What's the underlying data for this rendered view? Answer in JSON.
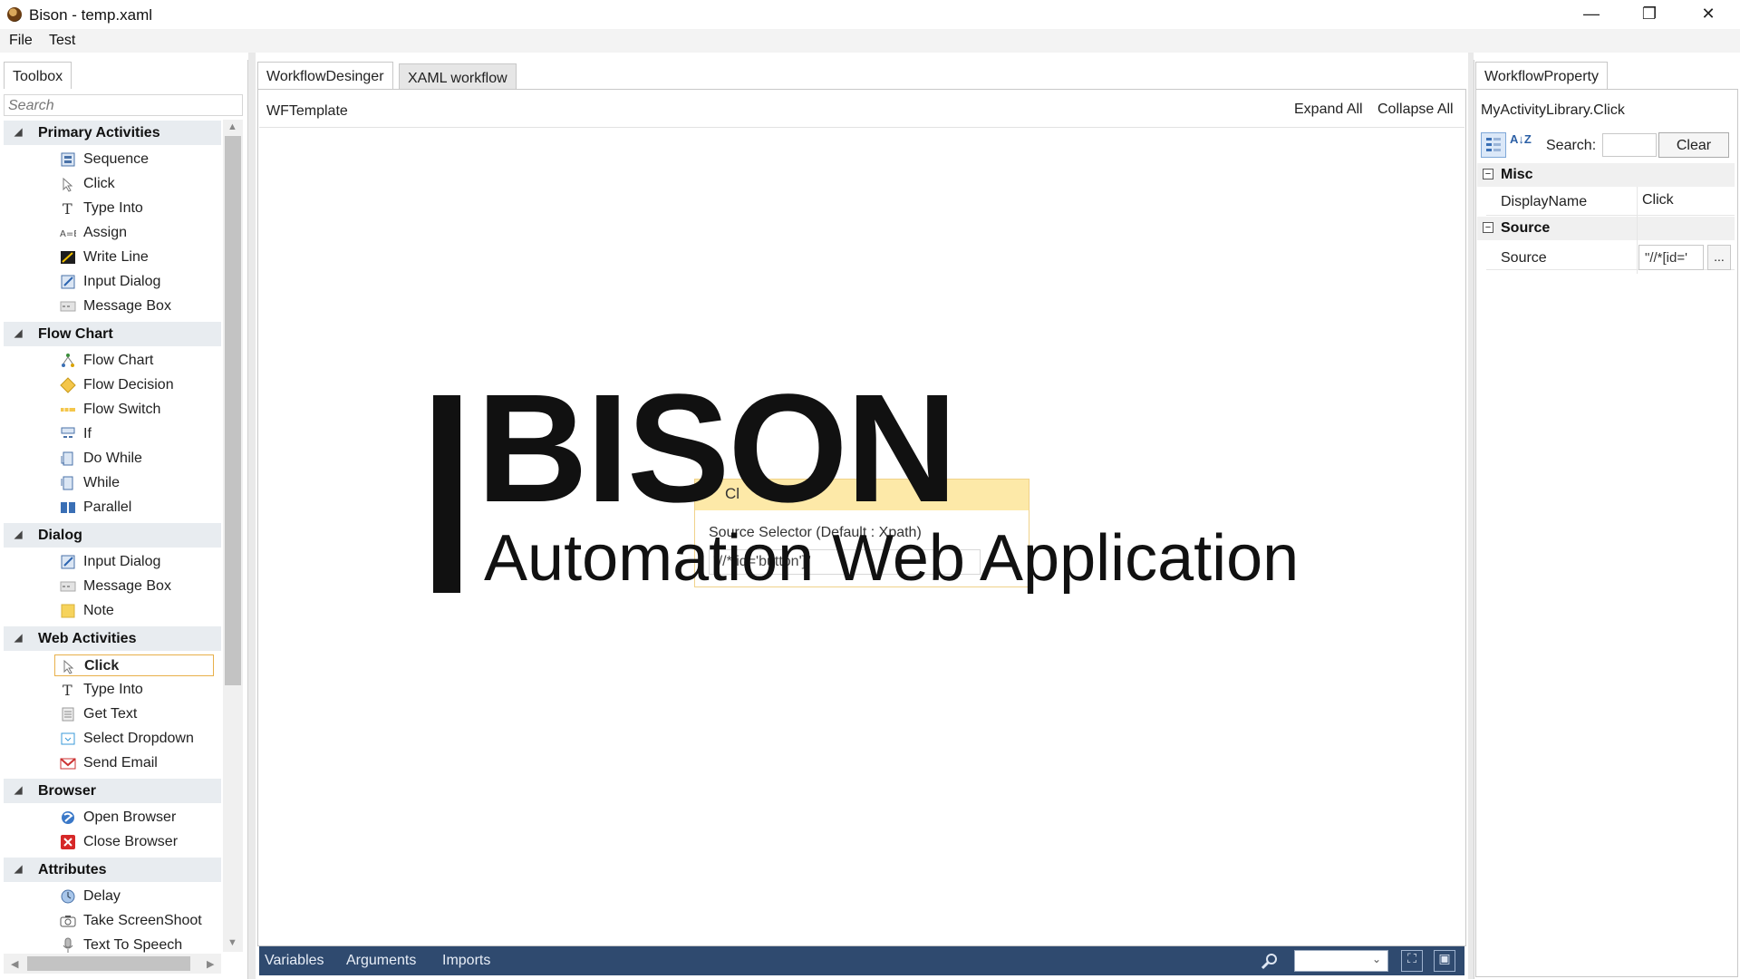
{
  "window": {
    "title": "Bison - temp.xaml",
    "controls": {
      "minimize": "—",
      "maximize": "❐",
      "close": "✕"
    }
  },
  "menu": {
    "file": "File",
    "test": "Test"
  },
  "toolbox": {
    "tab": "Toolbox",
    "search_placeholder": "Search",
    "categories": [
      {
        "name": "Primary Activities",
        "items": [
          {
            "label": "Sequence",
            "icon": "sequence-icon"
          },
          {
            "label": "Click",
            "icon": "click-icon"
          },
          {
            "label": "Type Into",
            "icon": "type-into-icon"
          },
          {
            "label": "Assign",
            "icon": "assign-icon"
          },
          {
            "label": "Write Line",
            "icon": "write-line-icon"
          },
          {
            "label": "Input Dialog",
            "icon": "input-dialog-icon"
          },
          {
            "label": "Message Box",
            "icon": "message-box-icon"
          }
        ]
      },
      {
        "name": "Flow Chart",
        "items": [
          {
            "label": "Flow Chart",
            "icon": "flow-chart-icon"
          },
          {
            "label": "Flow Decision",
            "icon": "flow-decision-icon"
          },
          {
            "label": "Flow Switch",
            "icon": "flow-switch-icon"
          },
          {
            "label": "If",
            "icon": "if-icon"
          },
          {
            "label": "Do While",
            "icon": "do-while-icon"
          },
          {
            "label": "While",
            "icon": "while-icon"
          },
          {
            "label": "Parallel",
            "icon": "parallel-icon"
          }
        ]
      },
      {
        "name": "Dialog",
        "items": [
          {
            "label": "Input Dialog",
            "icon": "input-dialog-icon"
          },
          {
            "label": "Message Box",
            "icon": "message-box-icon"
          },
          {
            "label": "Note",
            "icon": "note-icon"
          }
        ]
      },
      {
        "name": "Web Activities",
        "items": [
          {
            "label": "Click",
            "icon": "click-icon",
            "selected": true
          },
          {
            "label": "Type Into",
            "icon": "type-into-icon"
          },
          {
            "label": "Get Text",
            "icon": "get-text-icon"
          },
          {
            "label": "Select Dropdown",
            "icon": "select-dropdown-icon"
          },
          {
            "label": "Send Email",
            "icon": "send-email-icon"
          }
        ]
      },
      {
        "name": "Browser",
        "items": [
          {
            "label": "Open Browser",
            "icon": "open-browser-icon"
          },
          {
            "label": "Close Browser",
            "icon": "close-browser-icon"
          }
        ]
      },
      {
        "name": "Attributes",
        "items": [
          {
            "label": "Delay",
            "icon": "delay-icon"
          },
          {
            "label": "Take ScreenShoot",
            "icon": "camera-icon"
          },
          {
            "label": "Text To Speech",
            "icon": "microphone-icon"
          }
        ]
      }
    ]
  },
  "designer": {
    "tabs": {
      "designer": "WorkflowDesinger",
      "xaml": "XAML workflow"
    },
    "template_name": "WFTemplate",
    "expand_all": "Expand All",
    "collapse_all": "Collapse All",
    "activity": {
      "title": "Cl",
      "field_label": "Source Selector (Default : Xpath)",
      "field_value": "\"//*[id='button']\""
    },
    "watermark": {
      "title": "BISON",
      "subtitle": "Automation Web Application"
    },
    "bottom": {
      "variables": "Variables",
      "arguments": "Arguments",
      "imports": "Imports"
    }
  },
  "properties": {
    "tab": "WorkflowProperty",
    "type_name": "MyActivityLibrary.Click",
    "search_label": "Search:",
    "clear_label": "Clear",
    "alpha_sort": "A↓Z",
    "categories": {
      "misc": "Misc",
      "source": "Source"
    },
    "rows": {
      "displayname": {
        "name": "DisplayName",
        "value": "Click"
      },
      "source": {
        "name": "Source",
        "value": "\"//*[id='",
        "button": "..."
      }
    }
  }
}
